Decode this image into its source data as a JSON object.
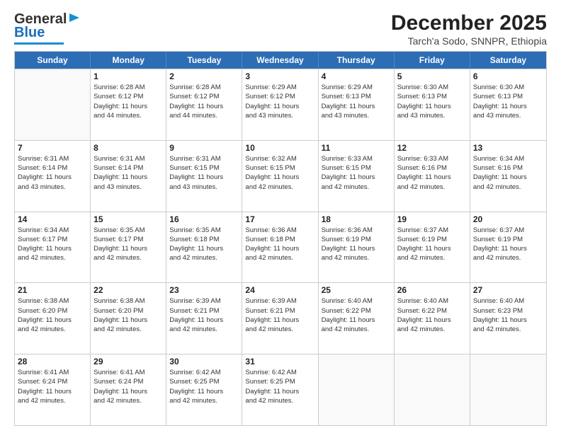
{
  "header": {
    "logo_general": "General",
    "logo_blue": "Blue",
    "month_title": "December 2025",
    "location": "Tarch'a Sodo, SNNPR, Ethiopia"
  },
  "weekdays": [
    "Sunday",
    "Monday",
    "Tuesday",
    "Wednesday",
    "Thursday",
    "Friday",
    "Saturday"
  ],
  "rows": [
    [
      {
        "day": "",
        "lines": []
      },
      {
        "day": "1",
        "lines": [
          "Sunrise: 6:28 AM",
          "Sunset: 6:12 PM",
          "Daylight: 11 hours",
          "and 44 minutes."
        ]
      },
      {
        "day": "2",
        "lines": [
          "Sunrise: 6:28 AM",
          "Sunset: 6:12 PM",
          "Daylight: 11 hours",
          "and 44 minutes."
        ]
      },
      {
        "day": "3",
        "lines": [
          "Sunrise: 6:29 AM",
          "Sunset: 6:12 PM",
          "Daylight: 11 hours",
          "and 43 minutes."
        ]
      },
      {
        "day": "4",
        "lines": [
          "Sunrise: 6:29 AM",
          "Sunset: 6:13 PM",
          "Daylight: 11 hours",
          "and 43 minutes."
        ]
      },
      {
        "day": "5",
        "lines": [
          "Sunrise: 6:30 AM",
          "Sunset: 6:13 PM",
          "Daylight: 11 hours",
          "and 43 minutes."
        ]
      },
      {
        "day": "6",
        "lines": [
          "Sunrise: 6:30 AM",
          "Sunset: 6:13 PM",
          "Daylight: 11 hours",
          "and 43 minutes."
        ]
      }
    ],
    [
      {
        "day": "7",
        "lines": [
          "Sunrise: 6:31 AM",
          "Sunset: 6:14 PM",
          "Daylight: 11 hours",
          "and 43 minutes."
        ]
      },
      {
        "day": "8",
        "lines": [
          "Sunrise: 6:31 AM",
          "Sunset: 6:14 PM",
          "Daylight: 11 hours",
          "and 43 minutes."
        ]
      },
      {
        "day": "9",
        "lines": [
          "Sunrise: 6:31 AM",
          "Sunset: 6:15 PM",
          "Daylight: 11 hours",
          "and 43 minutes."
        ]
      },
      {
        "day": "10",
        "lines": [
          "Sunrise: 6:32 AM",
          "Sunset: 6:15 PM",
          "Daylight: 11 hours",
          "and 42 minutes."
        ]
      },
      {
        "day": "11",
        "lines": [
          "Sunrise: 6:33 AM",
          "Sunset: 6:15 PM",
          "Daylight: 11 hours",
          "and 42 minutes."
        ]
      },
      {
        "day": "12",
        "lines": [
          "Sunrise: 6:33 AM",
          "Sunset: 6:16 PM",
          "Daylight: 11 hours",
          "and 42 minutes."
        ]
      },
      {
        "day": "13",
        "lines": [
          "Sunrise: 6:34 AM",
          "Sunset: 6:16 PM",
          "Daylight: 11 hours",
          "and 42 minutes."
        ]
      }
    ],
    [
      {
        "day": "14",
        "lines": [
          "Sunrise: 6:34 AM",
          "Sunset: 6:17 PM",
          "Daylight: 11 hours",
          "and 42 minutes."
        ]
      },
      {
        "day": "15",
        "lines": [
          "Sunrise: 6:35 AM",
          "Sunset: 6:17 PM",
          "Daylight: 11 hours",
          "and 42 minutes."
        ]
      },
      {
        "day": "16",
        "lines": [
          "Sunrise: 6:35 AM",
          "Sunset: 6:18 PM",
          "Daylight: 11 hours",
          "and 42 minutes."
        ]
      },
      {
        "day": "17",
        "lines": [
          "Sunrise: 6:36 AM",
          "Sunset: 6:18 PM",
          "Daylight: 11 hours",
          "and 42 minutes."
        ]
      },
      {
        "day": "18",
        "lines": [
          "Sunrise: 6:36 AM",
          "Sunset: 6:19 PM",
          "Daylight: 11 hours",
          "and 42 minutes."
        ]
      },
      {
        "day": "19",
        "lines": [
          "Sunrise: 6:37 AM",
          "Sunset: 6:19 PM",
          "Daylight: 11 hours",
          "and 42 minutes."
        ]
      },
      {
        "day": "20",
        "lines": [
          "Sunrise: 6:37 AM",
          "Sunset: 6:19 PM",
          "Daylight: 11 hours",
          "and 42 minutes."
        ]
      }
    ],
    [
      {
        "day": "21",
        "lines": [
          "Sunrise: 6:38 AM",
          "Sunset: 6:20 PM",
          "Daylight: 11 hours",
          "and 42 minutes."
        ]
      },
      {
        "day": "22",
        "lines": [
          "Sunrise: 6:38 AM",
          "Sunset: 6:20 PM",
          "Daylight: 11 hours",
          "and 42 minutes."
        ]
      },
      {
        "day": "23",
        "lines": [
          "Sunrise: 6:39 AM",
          "Sunset: 6:21 PM",
          "Daylight: 11 hours",
          "and 42 minutes."
        ]
      },
      {
        "day": "24",
        "lines": [
          "Sunrise: 6:39 AM",
          "Sunset: 6:21 PM",
          "Daylight: 11 hours",
          "and 42 minutes."
        ]
      },
      {
        "day": "25",
        "lines": [
          "Sunrise: 6:40 AM",
          "Sunset: 6:22 PM",
          "Daylight: 11 hours",
          "and 42 minutes."
        ]
      },
      {
        "day": "26",
        "lines": [
          "Sunrise: 6:40 AM",
          "Sunset: 6:22 PM",
          "Daylight: 11 hours",
          "and 42 minutes."
        ]
      },
      {
        "day": "27",
        "lines": [
          "Sunrise: 6:40 AM",
          "Sunset: 6:23 PM",
          "Daylight: 11 hours",
          "and 42 minutes."
        ]
      }
    ],
    [
      {
        "day": "28",
        "lines": [
          "Sunrise: 6:41 AM",
          "Sunset: 6:24 PM",
          "Daylight: 11 hours",
          "and 42 minutes."
        ]
      },
      {
        "day": "29",
        "lines": [
          "Sunrise: 6:41 AM",
          "Sunset: 6:24 PM",
          "Daylight: 11 hours",
          "and 42 minutes."
        ]
      },
      {
        "day": "30",
        "lines": [
          "Sunrise: 6:42 AM",
          "Sunset: 6:25 PM",
          "Daylight: 11 hours",
          "and 42 minutes."
        ]
      },
      {
        "day": "31",
        "lines": [
          "Sunrise: 6:42 AM",
          "Sunset: 6:25 PM",
          "Daylight: 11 hours",
          "and 42 minutes."
        ]
      },
      {
        "day": "",
        "lines": []
      },
      {
        "day": "",
        "lines": []
      },
      {
        "day": "",
        "lines": []
      }
    ]
  ]
}
